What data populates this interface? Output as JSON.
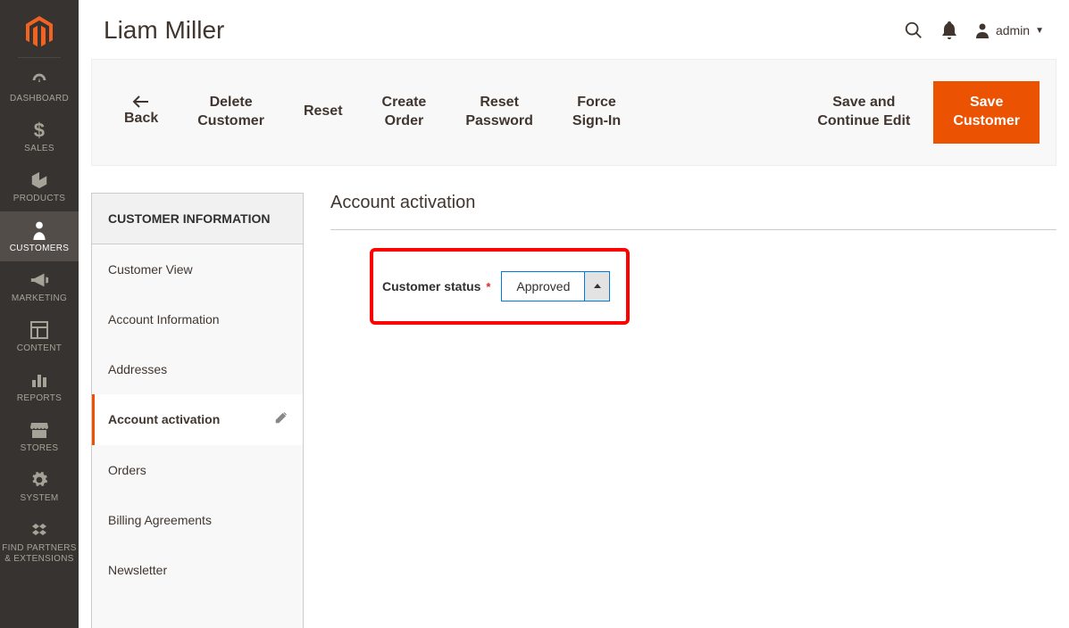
{
  "sidebar": {
    "items": [
      {
        "label": "DASHBOARD",
        "icon": "dashboard"
      },
      {
        "label": "SALES",
        "icon": "dollar"
      },
      {
        "label": "PRODUCTS",
        "icon": "box"
      },
      {
        "label": "CUSTOMERS",
        "icon": "person"
      },
      {
        "label": "MARKETING",
        "icon": "megaphone"
      },
      {
        "label": "CONTENT",
        "icon": "layout"
      },
      {
        "label": "REPORTS",
        "icon": "bars"
      },
      {
        "label": "STORES",
        "icon": "storefront"
      },
      {
        "label": "SYSTEM",
        "icon": "gear"
      },
      {
        "label": "FIND PARTNERS\n& EXTENSIONS",
        "icon": "blocks"
      }
    ]
  },
  "header": {
    "title": "Liam Miller",
    "user": "admin"
  },
  "actions": {
    "back": "Back",
    "delete": "Delete\nCustomer",
    "reset": "Reset",
    "create_order": "Create\nOrder",
    "reset_password": "Reset\nPassword",
    "force_signin": "Force\nSign-In",
    "save_continue": "Save and\nContinue Edit",
    "save": "Save\nCustomer"
  },
  "side_panel": {
    "title": "CUSTOMER INFORMATION",
    "tabs": [
      {
        "label": "Customer View"
      },
      {
        "label": "Account Information"
      },
      {
        "label": "Addresses"
      },
      {
        "label": "Account activation",
        "active": true,
        "editable": true
      },
      {
        "label": "Orders"
      },
      {
        "label": "Billing Agreements"
      },
      {
        "label": "Newsletter"
      }
    ]
  },
  "content": {
    "section_title": "Account activation",
    "field_label": "Customer status",
    "field_value": "Approved",
    "required": true
  }
}
